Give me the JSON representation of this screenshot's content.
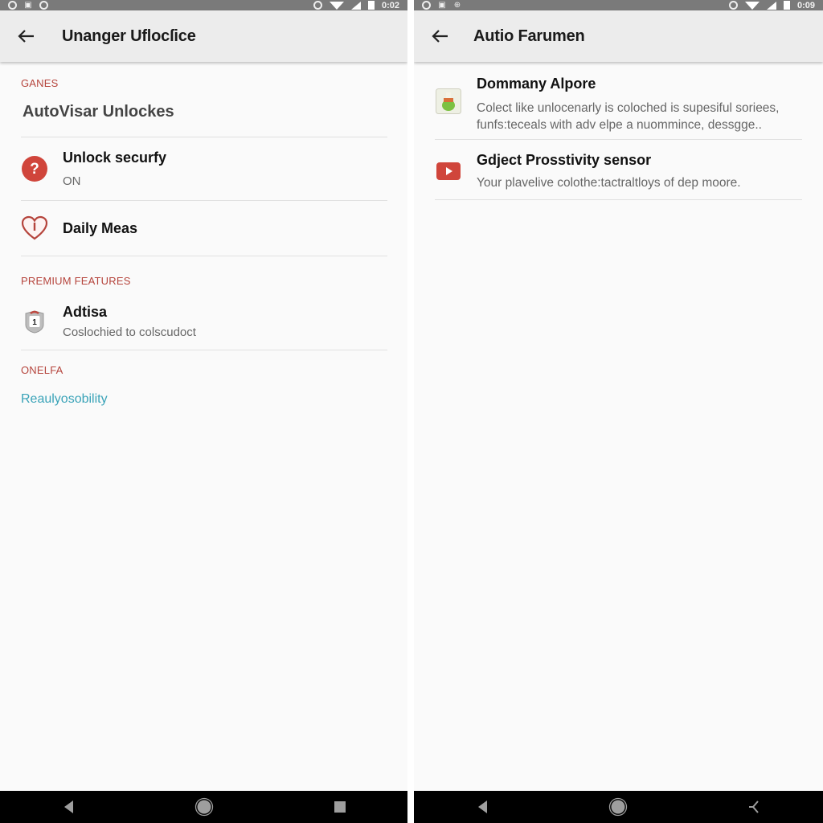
{
  "left": {
    "statusbar": {
      "time": "0:02"
    },
    "appbar": {
      "title": "Unanger Uflocſice",
      "back_icon": "arrow-back-icon"
    },
    "sections": [
      {
        "label": "GANES",
        "heading": "AutoVisar Unlockes"
      }
    ],
    "items": [
      {
        "title": "Unlock securfy",
        "subtitle": "ON",
        "icon": "help-circle-icon",
        "icon_color": "#d0453b"
      },
      {
        "title": "Daily Meas",
        "subtitle": "",
        "icon": "heart-alert-icon",
        "icon_color": "#b5443c"
      }
    ],
    "premium": {
      "label": "PREMIUM FEATURES",
      "items": [
        {
          "title": "Adtisa",
          "subtitle": "Coslochied to colscudoct",
          "icon": "shield-badge-icon",
          "badge_text": "1"
        }
      ]
    },
    "other": {
      "label": "ONELFA",
      "link": "Reaulyosobility",
      "link_color": "#3aa3b8"
    },
    "navbar": {
      "back": "nav-back-icon",
      "home": "nav-home-icon",
      "recents": "nav-recents-icon"
    }
  },
  "right": {
    "statusbar": {
      "time": "0:09"
    },
    "appbar": {
      "title": "Autio Farumen",
      "back_icon": "arrow-back-icon"
    },
    "items": [
      {
        "title": "Dommany Alpore",
        "subtitle": "Colect like unlocenarly is coloched is supesiful soriees, funfs:teceals with adv elpe a nuommince, dessgge..",
        "icon": "app-thumbnail-icon"
      },
      {
        "title": "Gdject  Prosstivity sensor",
        "subtitle": "Your plavelive colothe:tactraltloys of dep moore.",
        "icon": "video-play-icon",
        "icon_color": "#d0453b"
      }
    ],
    "navbar": {
      "back": "nav-back-icon",
      "home": "nav-home-icon",
      "recents": "nav-share-icon"
    }
  },
  "colors": {
    "accent_red": "#b5443c",
    "link_teal": "#3aa3b8",
    "statusbar": "#7a7a7a",
    "appbar": "#ececec",
    "navbar": "#000000"
  }
}
